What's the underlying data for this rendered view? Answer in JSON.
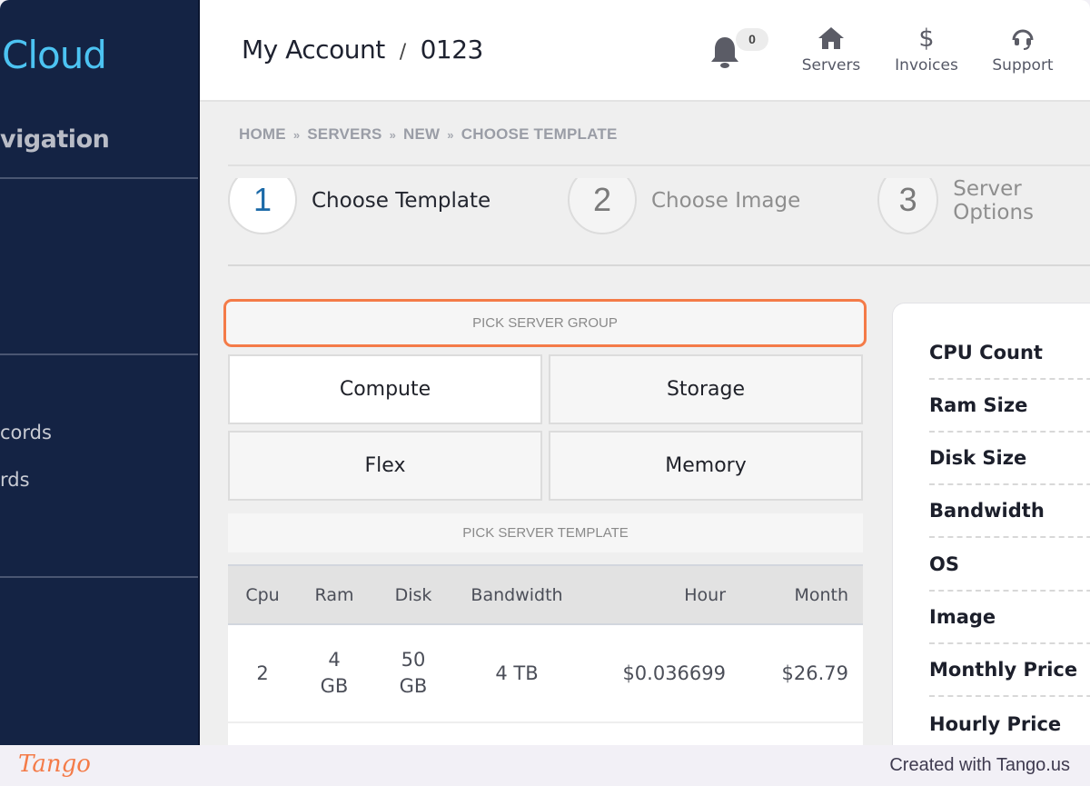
{
  "sidebar": {
    "logo_text": "Cloud",
    "nav_title": "vigation",
    "items": [
      {
        "label": "cords"
      },
      {
        "label": "rds"
      }
    ]
  },
  "header": {
    "title": "My Account",
    "title_separator": "/",
    "account_id": "0123",
    "notification_count": "0",
    "nav": [
      {
        "label": "Servers",
        "icon": "home-icon"
      },
      {
        "label": "Invoices",
        "icon": "dollar-icon"
      },
      {
        "label": "Support",
        "icon": "headset-icon"
      }
    ]
  },
  "breadcrumb": {
    "items": [
      "HOME",
      "SERVERS",
      "NEW",
      "CHOOSE TEMPLATE"
    ],
    "separator": "»"
  },
  "steps": [
    {
      "number": "1",
      "label": "Choose Template",
      "state": "active"
    },
    {
      "number": "2",
      "label": "Choose Image",
      "state": "inactive"
    },
    {
      "number": "3",
      "label": "Server Options",
      "state": "inactive"
    }
  ],
  "group_picker": {
    "heading": "PICK SERVER GROUP",
    "options": [
      {
        "label": "Compute",
        "selected": true
      },
      {
        "label": "Storage",
        "selected": false
      },
      {
        "label": "Flex",
        "selected": false
      },
      {
        "label": "Memory",
        "selected": false
      }
    ]
  },
  "template_picker": {
    "heading": "PICK SERVER TEMPLATE",
    "columns": [
      "Cpu",
      "Ram",
      "Disk",
      "Bandwidth",
      "Hour",
      "Month"
    ],
    "rows": [
      {
        "cpu": "2",
        "ram": "4 GB",
        "disk": "50 GB",
        "bandwidth": "4 TB",
        "hour": "$0.036699",
        "month": "$26.79"
      }
    ]
  },
  "summary": {
    "rows": [
      "CPU Count",
      "Ram Size",
      "Disk Size",
      "Bandwidth",
      "OS",
      "Image",
      "Monthly Price",
      "Hourly Price"
    ]
  },
  "footer": {
    "logo": "Tango",
    "credit": "Created with Tango.us"
  },
  "colors": {
    "sidebar_bg": "#142344",
    "logo": "#4cc3f2",
    "highlight": "#f47b48",
    "active_step": "#1c6aa8"
  }
}
